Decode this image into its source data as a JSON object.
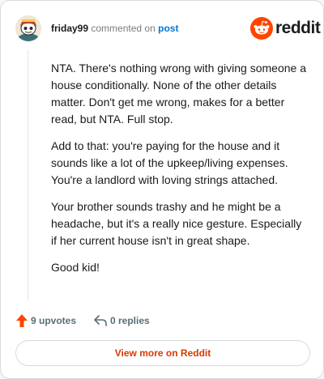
{
  "header": {
    "username": "friday99",
    "action": "commented on",
    "post_link": "post",
    "brand_name": "reddit",
    "brand_color": "#ff4500"
  },
  "comment": {
    "paragraphs": [
      "NTA. There's nothing wrong with giving someone a house conditionally. None of the other details matter. Don't get me wrong, makes for a better read, but NTA. Full stop.",
      "Add to that: you're paying for the house and it sounds like a lot of the upkeep/living expenses. You're a landlord with loving strings attached.",
      "Your brother sounds trashy and he might be a headache, but it's a really nice gesture. Especially if her current house isn't in great shape.",
      "Good kid!"
    ]
  },
  "actions": {
    "upvotes": "9 upvotes",
    "replies": "0 replies",
    "upvote_icon": "upvote-arrow-icon",
    "reply_icon": "reply-arrow-icon"
  },
  "footer": {
    "view_more": "View more on Reddit"
  }
}
